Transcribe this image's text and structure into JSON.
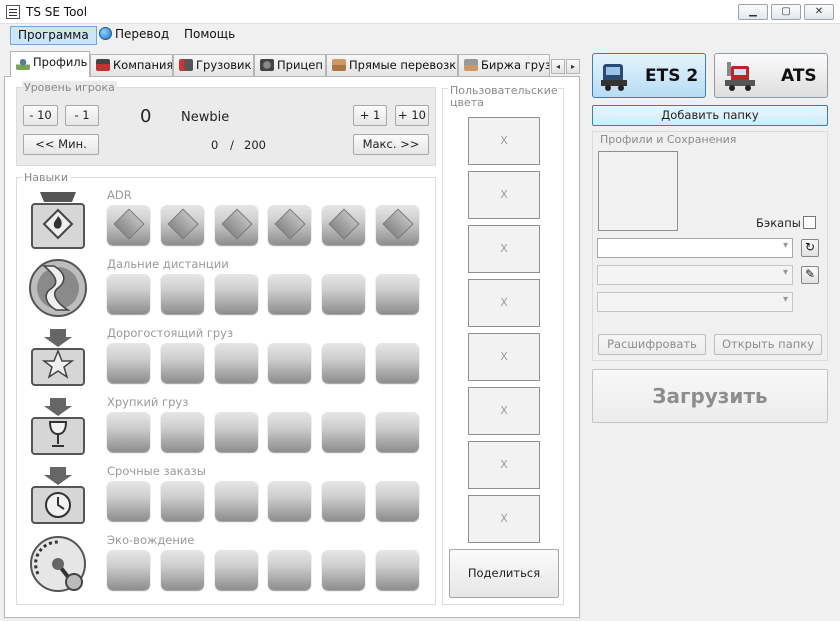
{
  "window": {
    "title": "TS SE Tool",
    "minimize": "▁",
    "maximize": "▢",
    "close": "✕"
  },
  "menu": {
    "items": [
      "Программа",
      "Перевод",
      "Помощь"
    ]
  },
  "tabs": [
    {
      "label": "Профиль",
      "icon": "profile-icon"
    },
    {
      "label": "Компания",
      "icon": "company-icon"
    },
    {
      "label": "Грузовик",
      "icon": "truck-icon"
    },
    {
      "label": "Прицеп",
      "icon": "trailer-icon"
    },
    {
      "label": "Прямые перевозки",
      "icon": "cargo-icon"
    },
    {
      "label": "Биржа грузо",
      "icon": "exchange-icon"
    }
  ],
  "tab_scroll": {
    "left": "◂",
    "right": "▸"
  },
  "player_level": {
    "title": "Уровень игрока",
    "minus10": "- 10",
    "minus1": "- 1",
    "level": "0",
    "rank": "Newbie",
    "plus1": "+ 1",
    "plus10": "+ 10",
    "min_label": "<< Мин.",
    "max_label": "Макс. >>",
    "xp_current": "0",
    "xp_sep": "/",
    "xp_total": "200"
  },
  "skills": {
    "title": "Навыки",
    "rows": [
      {
        "title": "ADR",
        "icon": "adr-skill-icon"
      },
      {
        "title": "Дальние дистанции",
        "icon": "long-distance-skill-icon"
      },
      {
        "title": "Дорогостоящий груз",
        "icon": "valuable-cargo-skill-icon"
      },
      {
        "title": "Хрупкий груз",
        "icon": "fragile-cargo-skill-icon"
      },
      {
        "title": "Срочные заказы",
        "icon": "urgent-delivery-skill-icon"
      },
      {
        "title": "Эко-вождение",
        "icon": "eco-driving-skill-icon"
      }
    ]
  },
  "custom_colors": {
    "title": "Пользовательские цвета",
    "slots": [
      "X",
      "X",
      "X",
      "X",
      "X",
      "X",
      "X",
      "X"
    ],
    "share_label": "Поделиться"
  },
  "games": {
    "ets": "ETS 2",
    "ats": "ATS"
  },
  "add_folder_label": "Добавить папку",
  "profiles": {
    "title": "Профили и Сохранения",
    "backups_label": "Бэкапы",
    "decrypt_label": "Расшифровать",
    "open_folder_label": "Открыть папку",
    "refresh_icon": "↻",
    "edit_icon": "✎"
  },
  "load_label": "Загрузить",
  "colors": {
    "accent": "#3c7fb1",
    "menu_active": "#cde6f7",
    "ets_bg": "#b7dcf4"
  }
}
